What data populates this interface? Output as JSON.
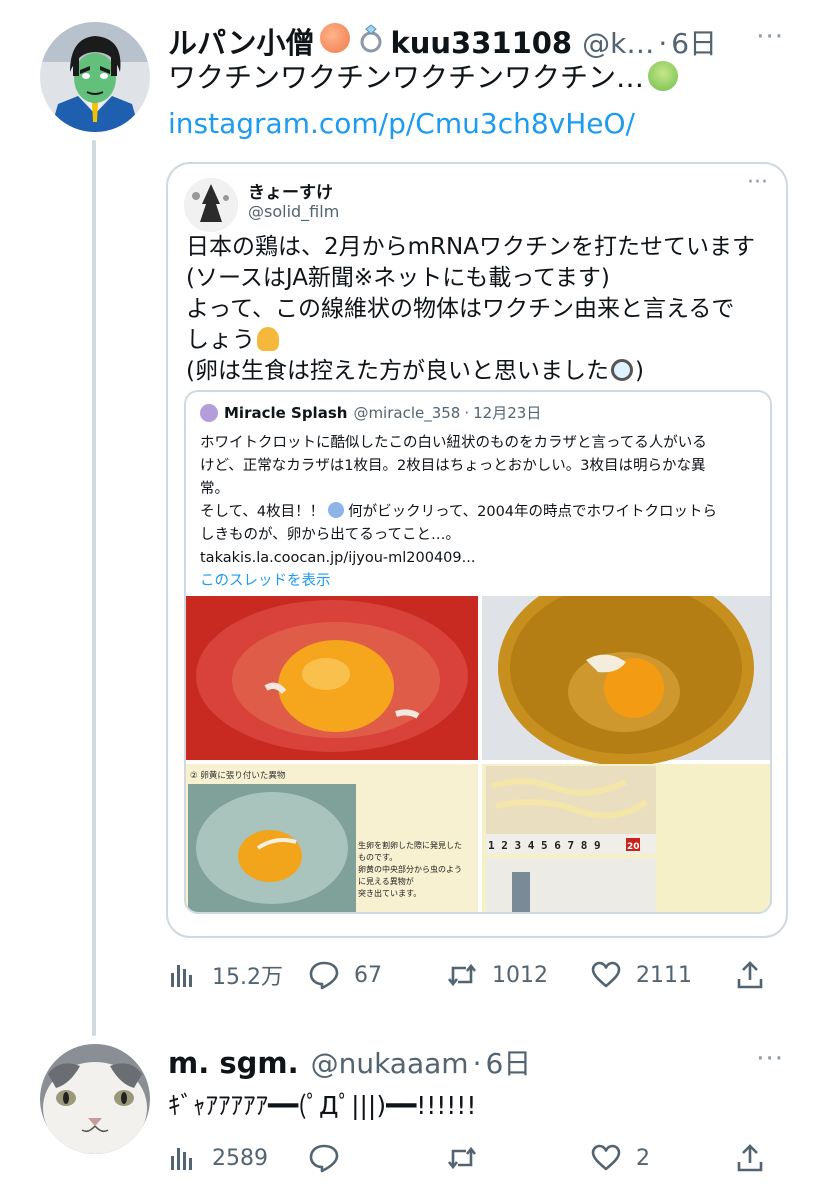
{
  "tweet1": {
    "name": "ルパン小僧",
    "name2": "kuu331108",
    "handle": "@k…",
    "dot": "·",
    "time": "6日",
    "more": "···",
    "text": "ワクチンワクチンワクチンワクチン…",
    "link": "instagram.com/p/Cmu3ch8vHeO/",
    "icons": [
      "peach-emoji-icon",
      "ring-emoji-icon",
      "nauseated-face-emoji-icon"
    ],
    "embedded": {
      "name": "きょーすけ",
      "handle": "@solid_film",
      "more": "···",
      "lines": [
        "日本の鶏は、2月からmRNAワクチンを打たせています",
        "(ソースはJA新聞※ネットにも載ってます)",
        "よって、この線維状の物体はワクチン由来と言えるで",
        "しょう",
        "(卵は生食は控えた方が良いと思いました"
      ],
      "line5_close": ")",
      "quote": {
        "name": "Miracle Splash",
        "handle": "@miracle_358",
        "dot": "·",
        "date": "12月23日",
        "lines": [
          "ホワイトクロットに酷似したこの白い紐状のものをカラザと言ってる人がいる",
          "けど、正常なカラザは1枚目。2枚目はちょっとおかしい。3枚目は明らかな異",
          "常。",
          "そして、4枚目！！",
          "何がビックリって、2004年の時点でホワイトクロットら",
          "しきものが、卵から出てるってこと…。",
          "takakis.la.coocan.jp/ijyou-ml200409..."
        ],
        "thread": "このスレッドを表示",
        "media": {
          "caption": "② 卵黄に張り付いた異物",
          "note": [
            "生卵を割卵した際に発見した",
            "ものです。",
            "卵黄の中央部分から虫のよう",
            "に見える異物が",
            "突き出ています。"
          ],
          "ruler": "1 2 3 4 5 6 7 8 9",
          "ruler_mark": "20"
        }
      }
    },
    "stats": {
      "views": "15.2万",
      "replies": "67",
      "retweets": "1012",
      "likes": "2111"
    }
  },
  "tweet2": {
    "name": "m. sgm.",
    "handle": "@nukaaam",
    "dot": "·",
    "time": "6日",
    "more": "···",
    "text": "ｷﾞｬｱｱｱｱｱ━━(ﾟДﾟ|||)━━!!!!!!",
    "stats": {
      "views": "2589",
      "replies": "",
      "retweets": "",
      "likes": "2"
    }
  },
  "colors": {
    "link": "#1d9bf0",
    "secondary": "#536471",
    "border": "#cfd9de"
  }
}
